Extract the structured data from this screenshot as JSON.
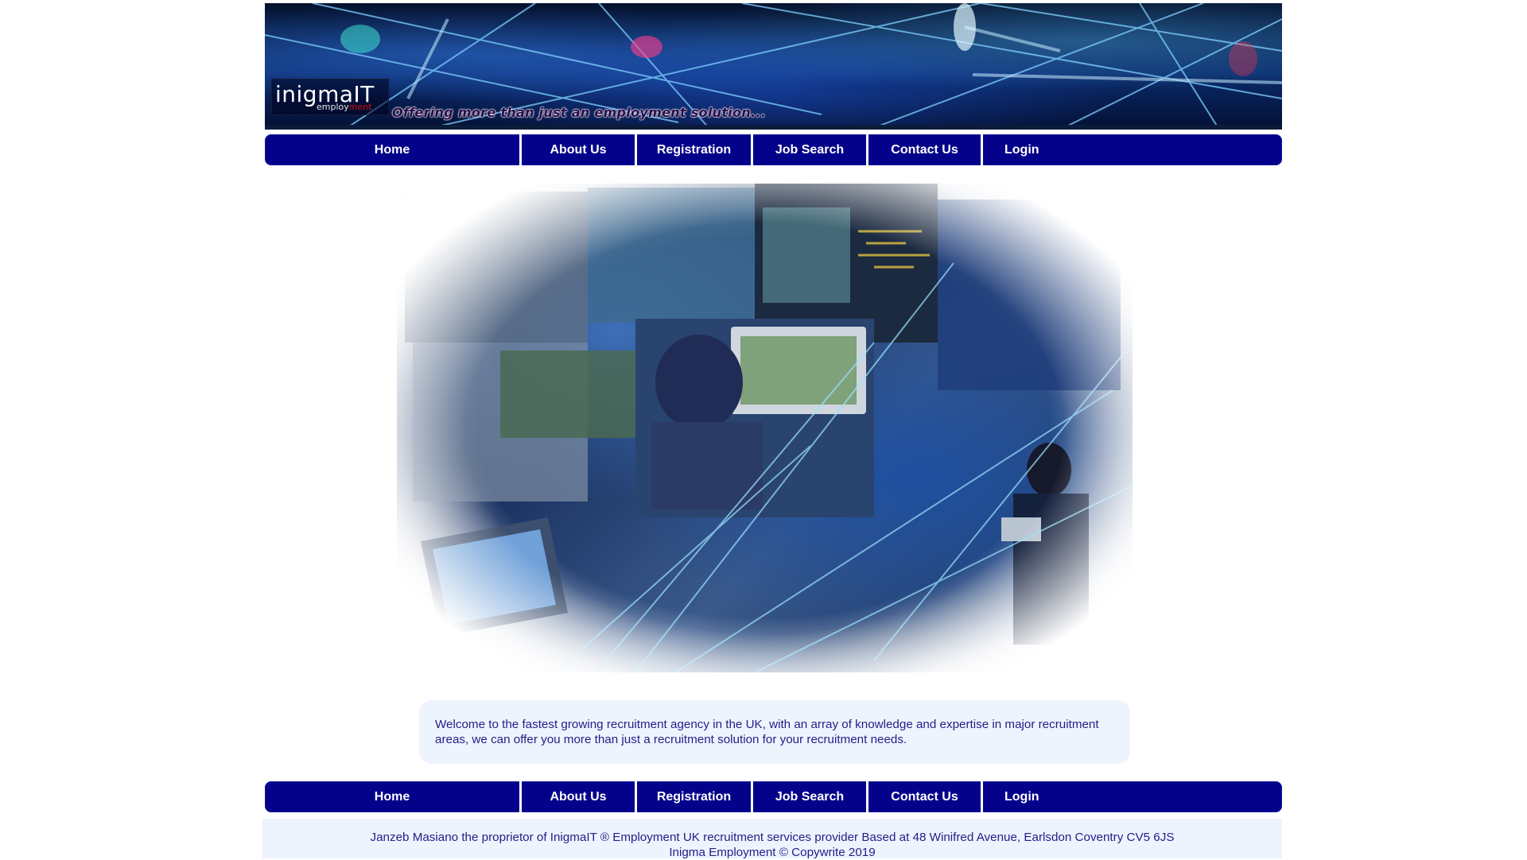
{
  "header": {
    "logo_main": "inigmaIT",
    "logo_sub_prefix": "employ",
    "logo_sub_suffix": "ment",
    "tagline": "Offering more than just an employment solution..."
  },
  "nav": {
    "items": [
      {
        "label": "Home"
      },
      {
        "label": "About Us"
      },
      {
        "label": "Registration"
      },
      {
        "label": "Job Search"
      },
      {
        "label": "Contact Us"
      },
      {
        "label": "Login"
      }
    ]
  },
  "welcome": {
    "text": "Welcome to the fastest growing recruitment agency in the UK, with an array of knowledge and expertise in major recruitment areas, we can offer you more than just a recruitment solution for your recruitment needs."
  },
  "footer": {
    "line1": "Janzeb Masiano the proprietor of InigmaIT ® Employment UK recruitment services provider Based at 48 Winifred Avenue, Earlsdon Coventry CV5 6JS",
    "line2": "Inigma Employment © Copywrite 2019"
  },
  "colors": {
    "nav_bg": "#04028a",
    "text_blue": "#23208a",
    "panel_bg": "#eef4fd"
  }
}
